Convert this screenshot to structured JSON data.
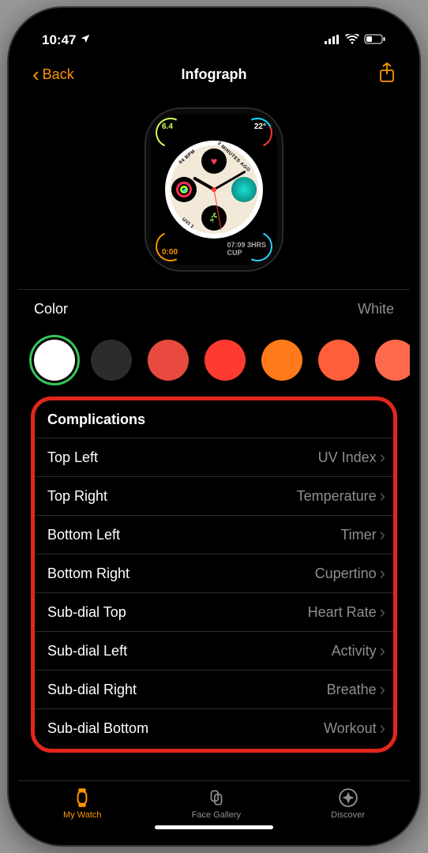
{
  "status": {
    "time": "10:47"
  },
  "nav": {
    "back": "Back",
    "title": "Infograph"
  },
  "preview": {
    "corner_tl": "6.4",
    "corner_tr": "22°",
    "corner_bl": "0:00",
    "corner_br_line1": "07:09  3HRS",
    "corner_br_line2": "CUP",
    "inner_tl": "64 BPM",
    "inner_tr": "3 MINUTES AGO",
    "inner_bl": "UVI 1",
    "inner_br": ""
  },
  "color": {
    "label": "Color",
    "value": "White"
  },
  "swatches": [
    {
      "hex": "#ffffff",
      "selected": true
    },
    {
      "hex": "#2c2c2e",
      "selected": false
    },
    {
      "hex": "#e84a3f",
      "selected": false
    },
    {
      "hex": "#ff3b30",
      "selected": false
    },
    {
      "hex": "#ff7a1a",
      "selected": false
    },
    {
      "hex": "#ff5e3a",
      "selected": false
    },
    {
      "hex": "#ff6a4d",
      "selected": false
    }
  ],
  "complications": {
    "header": "Complications",
    "rows": [
      {
        "label": "Top Left",
        "value": "UV Index"
      },
      {
        "label": "Top Right",
        "value": "Temperature"
      },
      {
        "label": "Bottom Left",
        "value": "Timer"
      },
      {
        "label": "Bottom Right",
        "value": "Cupertino"
      },
      {
        "label": "Sub-dial Top",
        "value": "Heart Rate"
      },
      {
        "label": "Sub-dial Left",
        "value": "Activity"
      },
      {
        "label": "Sub-dial Right",
        "value": "Breathe"
      },
      {
        "label": "Sub-dial Bottom",
        "value": "Workout"
      }
    ]
  },
  "tabs": [
    {
      "label": "My Watch",
      "active": true
    },
    {
      "label": "Face Gallery",
      "active": false
    },
    {
      "label": "Discover",
      "active": false
    }
  ]
}
